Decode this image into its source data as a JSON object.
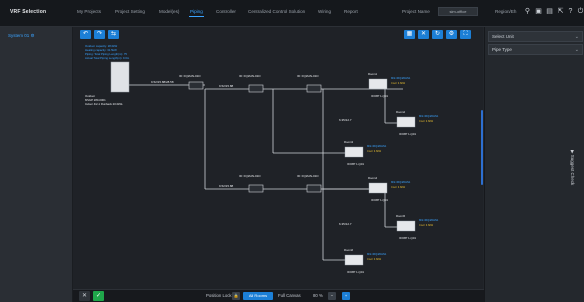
{
  "app": {
    "title": "VRF Selection"
  },
  "nav": {
    "items": [
      {
        "label": "My Projects",
        "active": false
      },
      {
        "label": "Project Setting",
        "active": false
      },
      {
        "label": "Model(es)",
        "active": false
      },
      {
        "label": "Piping",
        "active": true
      },
      {
        "label": "Controller",
        "active": false
      },
      {
        "label": "Centralized Control Solution",
        "active": false
      },
      {
        "label": "Wiring",
        "active": false
      },
      {
        "label": "Report",
        "active": false
      }
    ],
    "project_label": "Project Name",
    "project_value": "sim-office",
    "region": "Region/Eh"
  },
  "left_panel": {
    "item": "System 01 ⚙"
  },
  "outdoor_unit": {
    "lines": [
      "Outdoor capacity: 28.0kW",
      "Heating capacity: 31.5kW",
      "Piping: Total Piping Length(m): 75",
      "Actual Total Piping Length(m): 9.6m"
    ],
    "name": "Outdoor",
    "model": "MVHP 280-0001",
    "extra": "Indoor 4/2-1 Runback 20.0kW-"
  },
  "branch_labels": [
    "ID: FQZHN-01D",
    "ID: FQZHN-01D",
    "ID: FQZHN-01D",
    "ID: FQZHN-01D",
    "ID: FQZHN-01D"
  ],
  "pipe_labels": [
    "9.52/15.88/28.58",
    "9.52/15.88",
    "9.52/15.88",
    "6.35/12.7",
    "6.35/12.7"
  ],
  "indoor_units": [
    {
      "name": "Room1",
      "model": "MI2-36Q4/DHN1",
      "spec": "Cool: 3.6kW",
      "id": "ID:DBT 1-Q4/1"
    },
    {
      "name": "Room2",
      "model": "MI2-36Q4/DHN1",
      "spec": "Cool: 3.6kW",
      "id": "ID:DBT 1-Q4/1"
    },
    {
      "name": "Room3",
      "model": "MI2-36Q4/DHN1",
      "spec": "Cool: 3.6kW",
      "id": "ID:DBT 1-Q4/1"
    },
    {
      "name": "Room4",
      "model": "MI2-36Q4/DHN1",
      "spec": "Cool: 3.6kW",
      "id": "ID:DBT 1-Q4/1"
    },
    {
      "name": "Room5",
      "model": "MI2-36Q4/DHN1",
      "spec": "Cool: 3.6kW",
      "id": "ID:DBT 1-Q4/1"
    },
    {
      "name": "Room6",
      "model": "MI2-36Q4/DHN1",
      "spec": "Cool: 3.6kW",
      "id": "ID:DBT 1-Q4/1"
    }
  ],
  "bottom": {
    "position_lock": "Position Lock",
    "all_rooms": "All Rooms",
    "full_canvas": "Full Canvas",
    "zoom": "80 %"
  },
  "right_panel": {
    "select_unit": "Select Unit",
    "pipe_type": "Pipe Type",
    "suggest": "▶ Suggest Check"
  },
  "colors": {
    "accent": "#1c7fd6",
    "link": "#3aa3ff",
    "pipe": "#cfd3d8",
    "active_green": "#1fa64a"
  }
}
